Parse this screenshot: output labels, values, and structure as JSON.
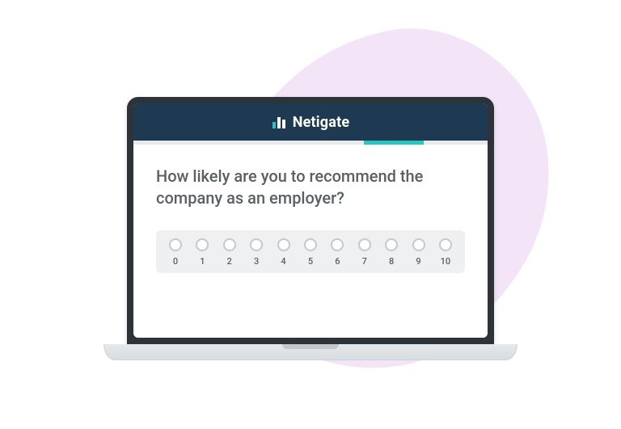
{
  "brand": {
    "name": "Netigate",
    "icon": "bar-chart-icon"
  },
  "progress": {
    "left_pct": 65,
    "width_pct": 17
  },
  "survey": {
    "question": "How likely are you to recommend the company as an employer?",
    "scale": {
      "options": [
        "0",
        "1",
        "2",
        "3",
        "4",
        "5",
        "6",
        "7",
        "8",
        "9",
        "10"
      ]
    }
  }
}
